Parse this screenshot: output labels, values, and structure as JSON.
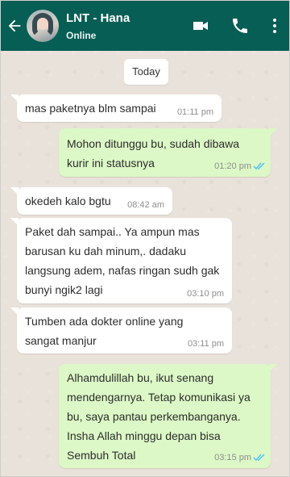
{
  "header": {
    "contact_name": "LNT - Hana",
    "status": "Online",
    "accent_color": "#075e54",
    "icons": [
      "back-arrow-icon",
      "avatar",
      "video-call-icon",
      "phone-icon",
      "more-vertical-icon"
    ]
  },
  "date_chip": "Today",
  "messages": [
    {
      "direction": "incoming",
      "text": "mas paketnya blm sampai",
      "time": "01:11 pm"
    },
    {
      "direction": "outgoing",
      "text": "Mohon ditunggu bu, sudah dibawa kurir ini statusnya",
      "time": "01:20 pm",
      "read": true
    },
    {
      "direction": "incoming",
      "text": "okedeh kalo bgtu",
      "time": "08:42 am"
    },
    {
      "direction": "incoming",
      "text": "Paket dah sampai.. Ya ampun mas barusan ku dah minum,. dadaku langsung adem, nafas ringan sudh gak bunyi ngik2 lagi",
      "time": "03:10 pm"
    },
    {
      "direction": "incoming",
      "text": "Tumben ada dokter online yang sangat manjur",
      "time": "03:11 pm"
    },
    {
      "direction": "outgoing",
      "text": "Alhamdulillah bu, ikut senang mendengarnya. Tetap komunikasi ya bu, saya pantau perkembanganya. Insha Allah minggu depan bisa Sembuh Total",
      "time": "03:15 pm",
      "read": true
    }
  ],
  "colors": {
    "incoming_bubble": "#ffffff",
    "outgoing_bubble": "#dcf8c6",
    "read_ticks": "#4fc3f7",
    "chat_background": "#e9e2da"
  }
}
